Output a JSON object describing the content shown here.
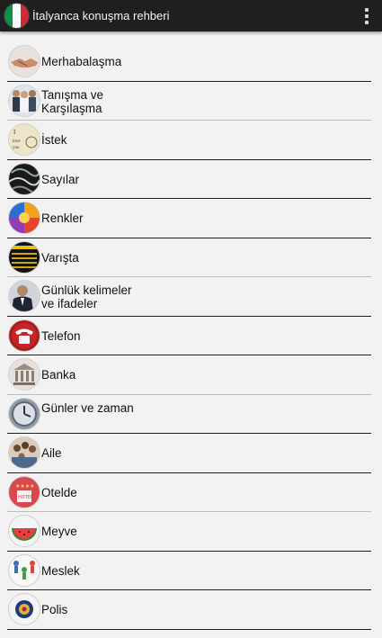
{
  "app": {
    "title": "İtalyanca konuşma rehberi",
    "flag_icon": "italy-flag-icon",
    "menu_icon": "overflow-menu-icon"
  },
  "categories": [
    {
      "label": "Merhabalaşma",
      "icon": "handshake-icon"
    },
    {
      "label": "Tanışma ve Karşılaşma",
      "icon": "people-meeting-icon"
    },
    {
      "label": "İstek",
      "icon": "i-love-you-note-icon"
    },
    {
      "label": "Sayılar",
      "icon": "numbers-icon"
    },
    {
      "label": "Renkler",
      "icon": "color-wheel-icon"
    },
    {
      "label": "Varışta",
      "icon": "arrival-board-icon"
    },
    {
      "label": "Günlük kelimeler ve ifadeler",
      "icon": "businessman-icon"
    },
    {
      "label": "Telefon",
      "icon": "telephone-icon"
    },
    {
      "label": "Banka",
      "icon": "bank-building-icon"
    },
    {
      "label": "Günler ve zaman",
      "icon": "clock-icon"
    },
    {
      "label": "Aile",
      "icon": "family-icon"
    },
    {
      "label": "Otelde",
      "icon": "hotel-icon"
    },
    {
      "label": "Meyve",
      "icon": "watermelon-icon"
    },
    {
      "label": "Meslek",
      "icon": "professions-icon"
    },
    {
      "label": "Polis",
      "icon": "police-badge-icon"
    }
  ]
}
